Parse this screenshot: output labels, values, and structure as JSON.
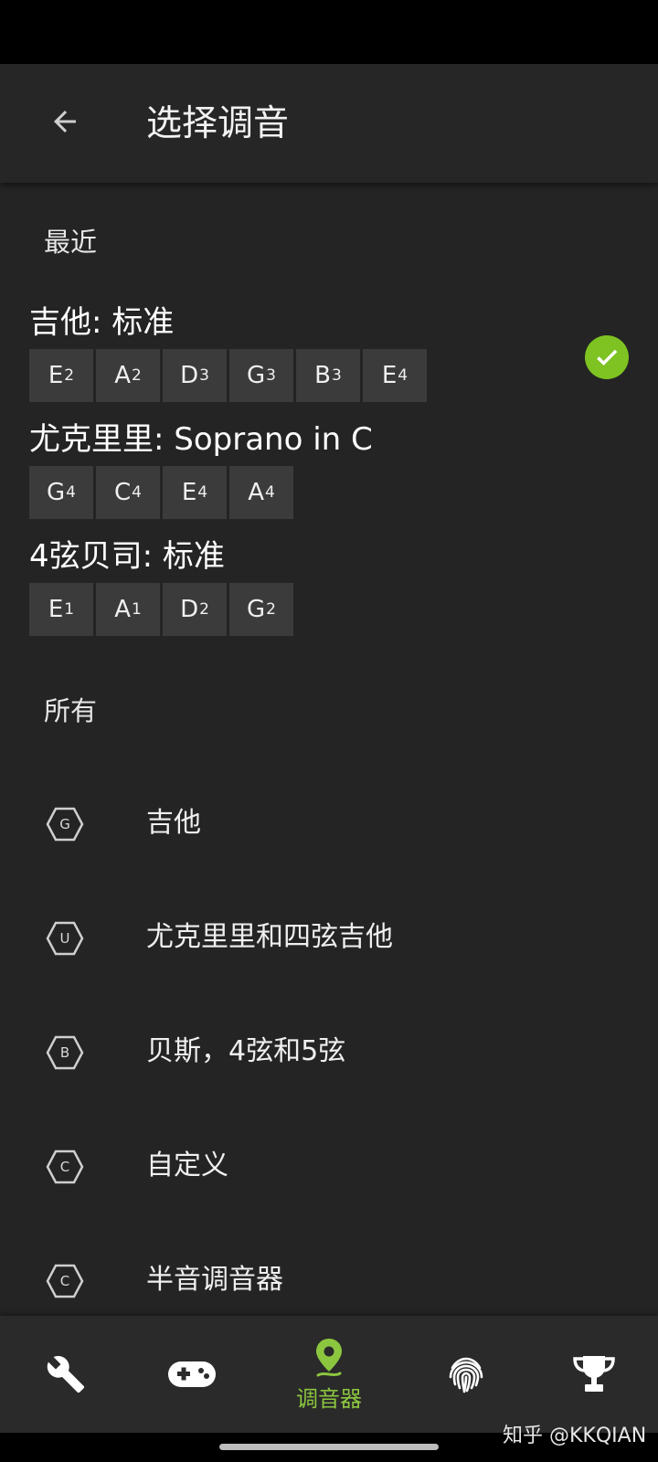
{
  "app_bar": {
    "title": "选择调音"
  },
  "recent": {
    "label": "最近",
    "tunings": [
      {
        "title": "吉他: 标准",
        "selected": true,
        "notes": [
          {
            "n": "E",
            "o": "2"
          },
          {
            "n": "A",
            "o": "2"
          },
          {
            "n": "D",
            "o": "3"
          },
          {
            "n": "G",
            "o": "3"
          },
          {
            "n": "B",
            "o": "3"
          },
          {
            "n": "E",
            "o": "4"
          }
        ]
      },
      {
        "title": "尤克里里: Soprano in C",
        "selected": false,
        "notes": [
          {
            "n": "G",
            "o": "4"
          },
          {
            "n": "C",
            "o": "4"
          },
          {
            "n": "E",
            "o": "4"
          },
          {
            "n": "A",
            "o": "4"
          }
        ]
      },
      {
        "title": "4弦贝司: 标准",
        "selected": false,
        "notes": [
          {
            "n": "E",
            "o": "1"
          },
          {
            "n": "A",
            "o": "1"
          },
          {
            "n": "D",
            "o": "2"
          },
          {
            "n": "G",
            "o": "2"
          }
        ]
      }
    ]
  },
  "all": {
    "label": "所有",
    "items": [
      {
        "badge": "G",
        "label": "吉他"
      },
      {
        "badge": "U",
        "label": "尤克里里和四弦吉他"
      },
      {
        "badge": "B",
        "label": "贝斯，4弦和5弦"
      },
      {
        "badge": "C",
        "label": "自定义"
      },
      {
        "badge": "C",
        "label": "半音调音器"
      }
    ]
  },
  "bottom_nav": {
    "items": [
      {
        "icon": "wrench-icon"
      },
      {
        "icon": "gamepad-icon"
      },
      {
        "icon": "tuner-pin-icon",
        "label": "调音器",
        "active": true
      },
      {
        "icon": "fingerprint-icon"
      },
      {
        "icon": "trophy-icon"
      }
    ]
  },
  "watermark": "知乎 @KKQIAN",
  "colors": {
    "accent": "#8cc63f",
    "check": "#7ec322",
    "background": "#242424",
    "note_tile": "#3b3b3b"
  }
}
